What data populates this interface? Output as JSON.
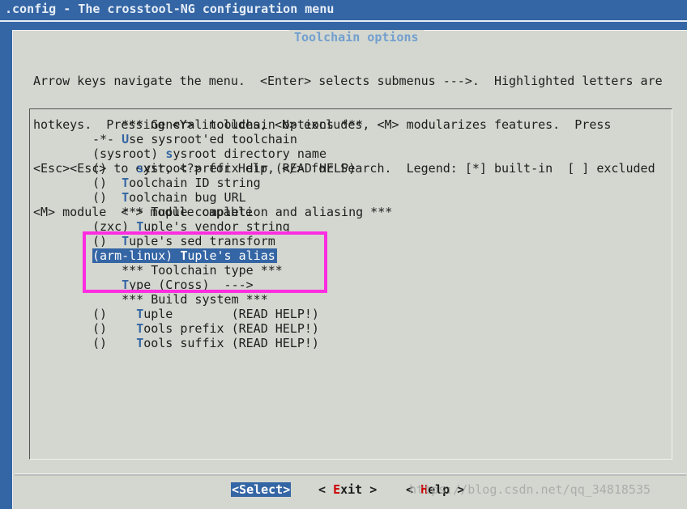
{
  "window": {
    "title": ".config - The crosstool-NG configuration menu"
  },
  "dialog": {
    "title": "Toolchain options",
    "help_lines": [
      "Arrow keys navigate the menu.  <Enter> selects submenus --->.  Highlighted letters are",
      "hotkeys.  Pressing <Y> includes, <N> excludes, <M> modularizes features.  Press",
      "<Esc><Esc> to exit, <?> for Help, </> for Search.  Legend: [*] built-in  [ ] excluded",
      "<M> module  < > module capable"
    ]
  },
  "menu": {
    "items": [
      {
        "prefix": "    *** General toolchain options ***",
        "hotkey": "",
        "rest": ""
      },
      {
        "prefix": "-*- ",
        "hotkey": "U",
        "rest": "se sysroot'ed toolchain"
      },
      {
        "prefix": "(sysroot) ",
        "hotkey": "s",
        "rest": "ysroot directory name"
      },
      {
        "prefix": "()    ",
        "hotkey": "s",
        "rest": "ysroot prefix dir (READ HELP)"
      },
      {
        "prefix": "()  ",
        "hotkey": "T",
        "rest": "oolchain ID string"
      },
      {
        "prefix": "()  ",
        "hotkey": "T",
        "rest": "oolchain bug URL"
      },
      {
        "prefix": "    *** Tuple completion and aliasing ***",
        "hotkey": "",
        "rest": ""
      },
      {
        "prefix": "(zxc) ",
        "hotkey": "T",
        "rest": "uple's vendor string"
      },
      {
        "prefix": "()  ",
        "hotkey": "T",
        "rest": "uple's sed transform"
      },
      {
        "prefix": "(arm-linux) ",
        "hotkey": "T",
        "rest": "uple's alias"
      },
      {
        "prefix": "    *** Toolchain type ***",
        "hotkey": "",
        "rest": ""
      },
      {
        "prefix": "    ",
        "hotkey": "T",
        "rest": "ype (Cross)  --->"
      },
      {
        "prefix": "    *** Build system ***",
        "hotkey": "",
        "rest": ""
      },
      {
        "prefix": "()    ",
        "hotkey": "T",
        "rest": "uple        (READ HELP!)"
      },
      {
        "prefix": "()    ",
        "hotkey": "T",
        "rest": "ools prefix (READ HELP!)"
      },
      {
        "prefix": "()    ",
        "hotkey": "T",
        "rest": "ools suffix (READ HELP!)"
      }
    ],
    "selected_index": 9
  },
  "buttons": {
    "select": {
      "open": "<",
      "first": "S",
      "rest": "elect",
      "close": ">"
    },
    "exit": {
      "open": "< ",
      "first": "E",
      "rest": "xit",
      "close": " >"
    },
    "help": {
      "open": "< ",
      "first": "H",
      "rest": "elp",
      "close": " >"
    }
  },
  "watermark": "https://blog.csdn.net/qq_34818535",
  "colors": {
    "background": "#3465a4",
    "dialog": "#d3d7cf",
    "hotkey": "#3465a4",
    "button_hotkey": "#cc0000",
    "annotation_box": "#ff2ce1"
  }
}
